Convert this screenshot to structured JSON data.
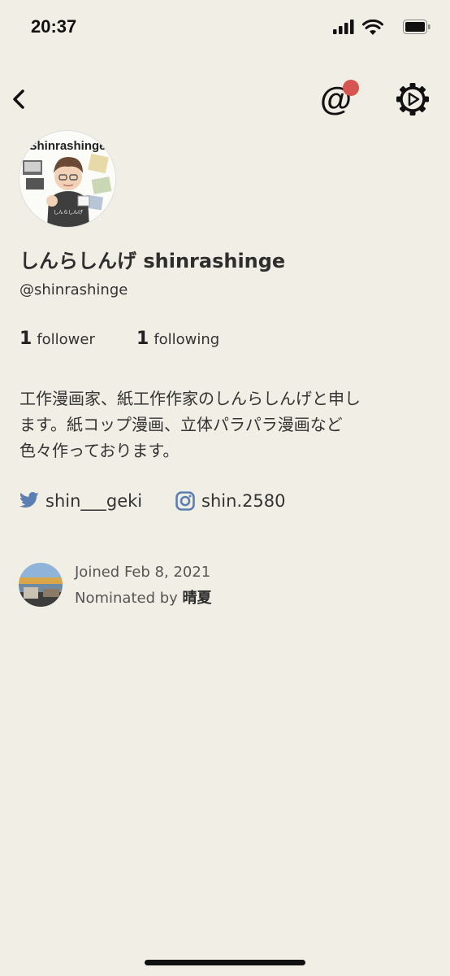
{
  "status_bar": {
    "time": "20:37"
  },
  "nav": {
    "mention_symbol": "@",
    "icons": {
      "back": "chevron-left-icon",
      "settings": "gear-icon"
    },
    "notification_color": "#d65550"
  },
  "profile": {
    "avatar_logo_text": "Shinrashinge",
    "avatar_shirt_text": "しんらしんげ",
    "name": "しんらしんげ shinrashinge",
    "handle": "@shinrashinge",
    "followers_count": "1",
    "followers_label": "follower",
    "following_count": "1",
    "following_label": "following",
    "bio_lines": [
      "工作漫画家、紙工作作家のしんらしんげと申し",
      "ます。紙コップ漫画、立体パラパラ漫画など",
      "色々作っております。"
    ]
  },
  "social": {
    "twitter_handle": "shin___geki",
    "instagram_handle": "shin.2580",
    "icon_color": "#5b7fb3"
  },
  "joined": {
    "date_text": "Joined Feb 8, 2021",
    "nominated_prefix": "Nominated by",
    "nominator": "晴夏"
  },
  "colors": {
    "background": "#f1eee5",
    "text": "#2b2b2b"
  }
}
